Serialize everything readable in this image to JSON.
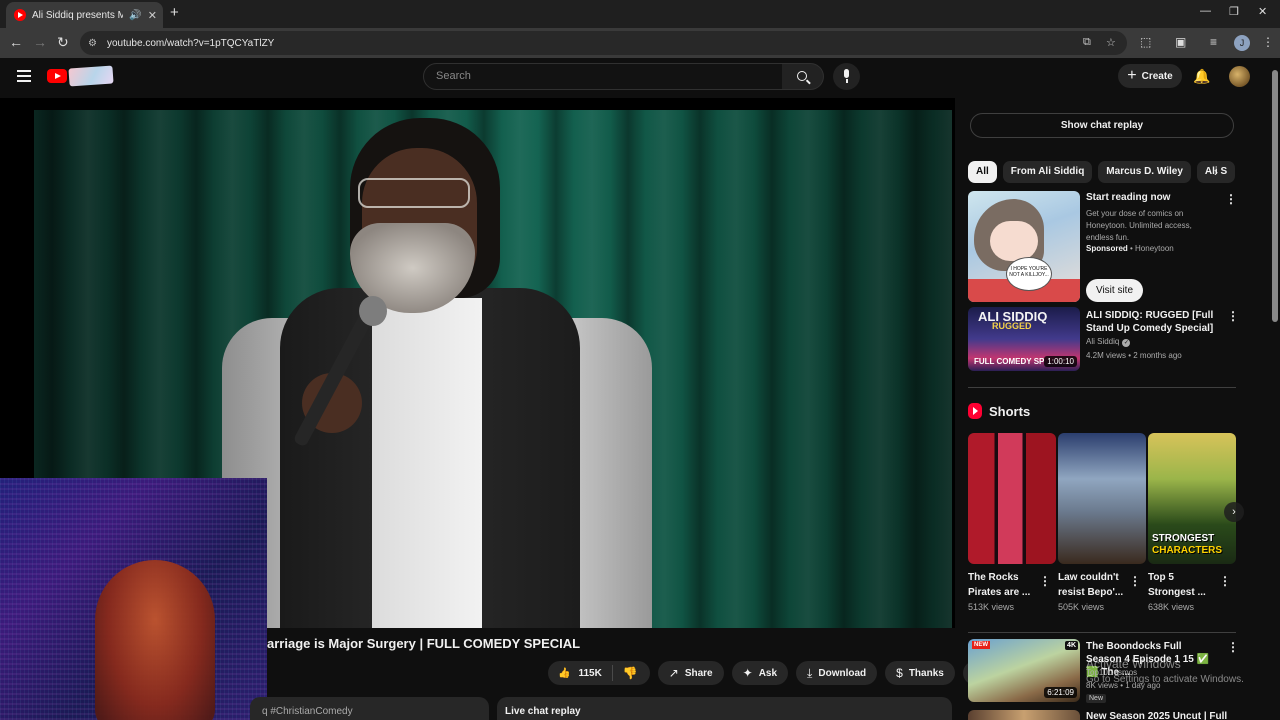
{
  "browser": {
    "tab_title": "Ali Siddiq presents Marcus",
    "tab_audio_icon": "speaker-icon",
    "url": "youtube.com/watch?v=1pTQCYaTlZY",
    "profile_initial": "J"
  },
  "masthead": {
    "search_placeholder": "Search",
    "create_label": "Create"
  },
  "player": {
    "video_title": "arriage is Major Surgery | FULL COMEDY SPECIAL"
  },
  "actions": {
    "likes": "115K",
    "share": "Share",
    "ask": "Ask",
    "download": "Download",
    "thanks": "Thanks"
  },
  "below": {
    "description_snippet": "q #ChristianComedy",
    "live_chat_replay": "Live chat replay"
  },
  "sidebar": {
    "show_chat_replay": "Show chat replay",
    "chips": [
      "All",
      "From Ali Siddiq",
      "Marcus D. Wiley",
      "Ali S"
    ],
    "ad": {
      "title": "Start reading now",
      "description": "Get your dose of comics on Honeytoon. Unlimited access, endless fun.",
      "sponsored": "Sponsored",
      "advertiser": "Honeytoon",
      "cta": "Visit site",
      "bubble_text": "I HOPE YOU'RE NOT A KILLJOY..."
    },
    "video1": {
      "title": "ALI SIDDIQ: RUGGED [Full Stand Up Comedy Special]",
      "channel": "Ali Siddiq",
      "meta": "4.2M views • 2 months ago",
      "duration": "1:00:10",
      "thumb_line1": "ALI SIDDIQ",
      "thumb_line2": "RUGGED",
      "thumb_line3": "FULL COMEDY SP"
    },
    "shorts_header": "Shorts",
    "shorts": [
      {
        "title": "The Rocks Pirates are ...",
        "views": "513K views"
      },
      {
        "title": "Law couldn't resist Bepo'...",
        "views": "505K views"
      },
      {
        "title": "Top 5 Strongest ...",
        "views": "638K views"
      }
    ],
    "shorts_thumb3_text1": "STRONGEST",
    "shorts_thumb3_text2": "CHARACTERS",
    "video2": {
      "title": "The Boondocks Full Season 4 Episode 1 15 ✅ 🟩 The ...",
      "channel": "Top10Cosmos",
      "meta": "8K views • 1 day ago",
      "badge": "New",
      "duration": "6:21:09",
      "quality": "4K",
      "thumb_tag": "NEW"
    },
    "video3": {
      "title": "New Season 2025 Uncut | Full"
    },
    "overlay_line1": "Activate Windows",
    "overlay_line2": "Go to Settings to activate Windows."
  }
}
